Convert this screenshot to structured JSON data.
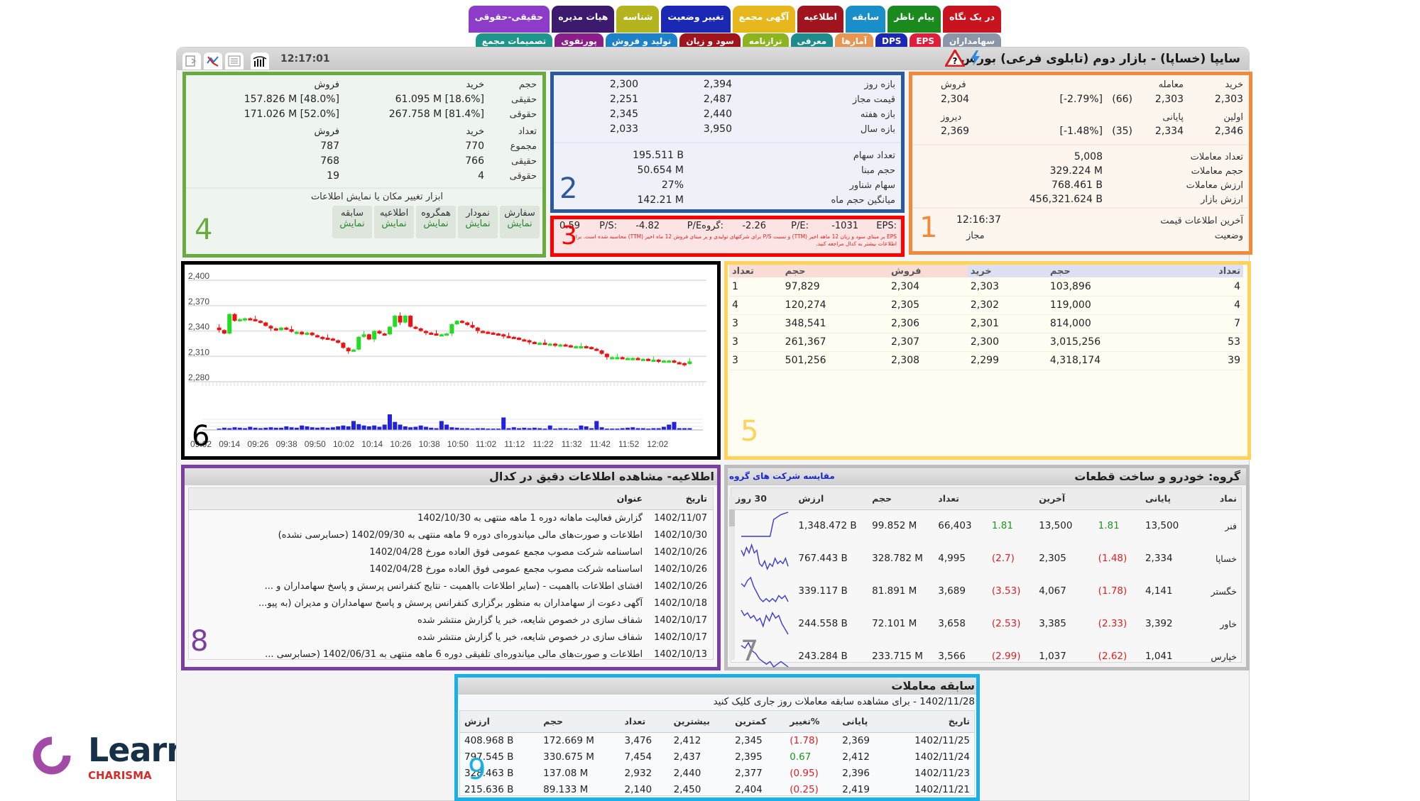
{
  "tabs": {
    "top": [
      {
        "label": "در یک نگاه",
        "color": "#c8141e"
      },
      {
        "label": "پیام ناظر",
        "color": "#1a8a1e"
      },
      {
        "label": "سابقه",
        "color": "#1a8ec8"
      },
      {
        "label": "اطلاعیه",
        "color": "#a0141e"
      },
      {
        "label": "آگهی مجمع",
        "color": "#e6b81e"
      },
      {
        "label": "تغییر وضعیت",
        "color": "#1a28b4"
      },
      {
        "label": "شناسه",
        "color": "#b4b41e"
      },
      {
        "label": "هیات مدیره",
        "color": "#3c1a6e"
      },
      {
        "label": "حقیقی-حقوقی",
        "color": "#8c3cc8"
      }
    ],
    "bottom": [
      {
        "label": "سهامداران",
        "color": "#8a96a8"
      },
      {
        "label": "EPS",
        "color": "#e01e3c"
      },
      {
        "label": "DPS",
        "color": "#1a28b4"
      },
      {
        "label": "آمارها",
        "color": "#e69650"
      },
      {
        "label": "معرفی",
        "color": "#1e8c8c"
      },
      {
        "label": "ترازنامه",
        "color": "#8cb41e"
      },
      {
        "label": "سود و زیان",
        "color": "#a0141e"
      },
      {
        "label": "تولید و فروش",
        "color": "#1e82c8"
      },
      {
        "label": "پورتفوی",
        "color": "#8c1e8c"
      },
      {
        "label": "تصمیمات مجمع",
        "color": "#1e968c"
      }
    ]
  },
  "window": {
    "title": "سایپا (خساپا) - بازار دوم (تابلوی فرعی) بورس",
    "clock": "12:17:01",
    "toolbar_icons": [
      "export-icon",
      "chart-line-icon",
      "list-icon",
      "bar-chart-icon"
    ]
  },
  "panel1": {
    "number": "1",
    "labels": {
      "buy": "خرید",
      "trade": "معامله",
      "sell": "فروش",
      "first": "اولین",
      "close": "پایانی",
      "yesterday": "دیروز"
    },
    "buy": "2,303",
    "trade_price": "2,303",
    "trade_change": "(66)",
    "trade_pct": "[-2.79%]",
    "sell": "2,304",
    "first": "2,346",
    "close_price": "2,334",
    "close_change": "(35)",
    "close_pct": "[-1.48%]",
    "yesterday": "2,369",
    "stats": [
      {
        "label": "تعداد معاملات",
        "value": "5,008"
      },
      {
        "label": "حجم معاملات",
        "value": "329.224 M"
      },
      {
        "label": "ارزش معاملات",
        "value": "768.461 B"
      },
      {
        "label": "ارزش بازار",
        "value": "456,321.624 B"
      }
    ],
    "last_update_label": "آخرین اطلاعات قیمت",
    "last_update": "12:16:37",
    "status_label": "وضعیت",
    "status": "مجاز"
  },
  "panel2": {
    "number": "2",
    "ranges": [
      {
        "label": "بازه روز",
        "high": "2,394",
        "low": "2,300"
      },
      {
        "label": "قیمت مجاز",
        "high": "2,487",
        "low": "2,251"
      },
      {
        "label": "بازه هفته",
        "high": "2,440",
        "low": "2,345"
      },
      {
        "label": "بازه سال",
        "high": "3,950",
        "low": "2,033"
      }
    ],
    "stats": [
      {
        "label": "تعداد سهام",
        "value": "195.511 B"
      },
      {
        "label": "حجم مبنا",
        "value": "50.654 M"
      },
      {
        "label": "سهام شناور",
        "value": "27%"
      },
      {
        "label": "میانگین حجم ماه",
        "value": "142.21 M"
      }
    ]
  },
  "panel3": {
    "number": "3",
    "eps_label": ":EPS",
    "eps": "1031-",
    "pe_label": ":P/E",
    "pe": "2.26-",
    "group_pe_label": ":گروهP/E",
    "group_pe": "4.82-",
    "ps_label": ":P/S",
    "ps": "0.59",
    "note": "EPS بر مبنای سود و زیان 12 ماهه اخیر (TTM) و نسبت P/S برای شرکتهای تولیدی و بر مبنای فروش 12 ماه اخیر (TTM) محاسبه شده است. برای اطلاعات بیشتر به کدال مراجعه کنید."
  },
  "panel4": {
    "number": "4",
    "vol_header": {
      "label": "حجم",
      "buy": "خرید",
      "sell": "فروش"
    },
    "vol_rows": [
      {
        "label": "حقیقی",
        "buy": "61.095 M [18.6%]",
        "sell": "157.826 M [48.0%]"
      },
      {
        "label": "حقوقی",
        "buy": "267.758 M [81.4%]",
        "sell": "171.026 M [52.0%]"
      }
    ],
    "count_header": {
      "label": "تعداد",
      "buy": "خرید",
      "sell": "فروش"
    },
    "count_rows": [
      {
        "label": "مجموع",
        "buy": "770",
        "sell": "787"
      },
      {
        "label": "حقیقی",
        "buy": "766",
        "sell": "768"
      },
      {
        "label": "حقوقی",
        "buy": "4",
        "sell": "19"
      }
    ],
    "tool_caption": "ابزار تغییر مکان یا نمایش اطلاعات",
    "tool_buttons": [
      {
        "label": "سفارش",
        "action": "نمایش"
      },
      {
        "label": "نمودار",
        "action": "نمایش"
      },
      {
        "label": "همگروه",
        "action": "نمایش"
      },
      {
        "label": "اطلاعیه",
        "action": "نمایش"
      },
      {
        "label": "سابقه",
        "action": "نمایش"
      }
    ]
  },
  "panel5": {
    "number": "5",
    "headers": [
      "تعداد",
      "حجم",
      "خرید",
      "فروش",
      "حجم",
      "تعداد"
    ],
    "rows": [
      {
        "buy_count": "4",
        "buy_vol": "103,896",
        "buy_price": "2,303",
        "sell_price": "2,304",
        "sell_vol": "97,829",
        "sell_count": "1"
      },
      {
        "buy_count": "4",
        "buy_vol": "119,000",
        "buy_price": "2,302",
        "sell_price": "2,305",
        "sell_vol": "120,274",
        "sell_count": "4"
      },
      {
        "buy_count": "7",
        "buy_vol": "814,000",
        "buy_price": "2,301",
        "sell_price": "2,306",
        "sell_vol": "348,541",
        "sell_count": "3"
      },
      {
        "buy_count": "53",
        "buy_vol": "3,015,256",
        "buy_price": "2,300",
        "sell_price": "2,307",
        "sell_vol": "261,367",
        "sell_count": "3"
      },
      {
        "buy_count": "39",
        "buy_vol": "4,318,174",
        "buy_price": "2,299",
        "sell_price": "2,308",
        "sell_vol": "501,256",
        "sell_count": "3"
      }
    ]
  },
  "panel6": {
    "number": "6"
  },
  "chart_data": {
    "type": "candlestick",
    "title": "",
    "ylim": [
      2280,
      2400
    ],
    "y_ticks": [
      "2,400",
      "2,370",
      "2,340",
      "2,310",
      "2,280"
    ],
    "y_tick_values": [
      2400,
      2370,
      2340,
      2310,
      2280
    ],
    "x_ticks": [
      "09:02",
      "09:14",
      "09:26",
      "09:38",
      "09:50",
      "10:02",
      "10:14",
      "10:26",
      "10:38",
      "10:50",
      "11:02",
      "11:12",
      "11:22",
      "11:32",
      "11:42",
      "11:52",
      "12:02"
    ],
    "up_color": "#22dd22",
    "down_color": "#ee1111",
    "volume_color": "#2222dd",
    "close": [
      2341,
      2337,
      2360,
      2352,
      2354,
      2355,
      2354,
      2352,
      2350,
      2346,
      2343,
      2341,
      2344,
      2342,
      2339,
      2339,
      2336,
      2338,
      2335,
      2333,
      2332,
      2331,
      2329,
      2326,
      2320,
      2316,
      2318,
      2333,
      2336,
      2330,
      2340,
      2337,
      2336,
      2345,
      2358,
      2350,
      2358,
      2345,
      2343,
      2340,
      2338,
      2337,
      2336,
      2336,
      2337,
      2348,
      2352,
      2350,
      2347,
      2344,
      2340,
      2339,
      2338,
      2337,
      2336,
      2334,
      2333,
      2332,
      2330,
      2329,
      2327,
      2326,
      2326,
      2325,
      2325,
      2324,
      2324,
      2323,
      2322,
      2322,
      2322,
      2321,
      2319,
      2317,
      2313,
      2309,
      2309,
      2309,
      2308,
      2308,
      2308,
      2307,
      2307,
      2306,
      2306,
      2305,
      2305,
      2305,
      2303,
      2302,
      2301,
      2304
    ],
    "volume": [
      0.3,
      0.5,
      0.4,
      0.6,
      0.5,
      0.4,
      0.7,
      0.5,
      0.4,
      0.5,
      0.6,
      0.5,
      0.5,
      0.8,
      0.6,
      0.5,
      1.0,
      0.8,
      0.6,
      0.5,
      0.6,
      0.5,
      0.6,
      0.8,
      1.0,
      0.8,
      2.0,
      1.3,
      1.0,
      0.8,
      1.0,
      0.7,
      1.2,
      3.5,
      1.8,
      1.2,
      0.8,
      0.6,
      0.7,
      1.0,
      0.7,
      0.5,
      0.4,
      2.0,
      1.2,
      0.6,
      0.5,
      0.4,
      0.4,
      0.3,
      0.4,
      0.4,
      0.3,
      0.3,
      0.3,
      2.8,
      0.4,
      0.6,
      0.4,
      0.5,
      0.4,
      0.5,
      0.4,
      0.3,
      1.0,
      0.3,
      0.4,
      0.4,
      0.3,
      0.3,
      1.0,
      0.8,
      0.4,
      2.0,
      0.6,
      0.3,
      0.3,
      0.3,
      0.4,
      0.5,
      0.6,
      0.4,
      0.4,
      0.3,
      0.4,
      0.4,
      0.7,
      1.2,
      1.8,
      0.4,
      0.4,
      0.4
    ],
    "legend": "none",
    "grid": true
  },
  "panel7": {
    "number": "7",
    "title": "گروه: خودرو و ساخت قطعات",
    "compare_link": "مقایسه شرکت های گروه",
    "headers": [
      "نماد",
      "پایانی",
      "",
      "آخرین",
      "",
      "تعداد",
      "حجم",
      "ارزش",
      "30 روز"
    ],
    "rows": [
      {
        "symbol": "فنر",
        "close": "13,500",
        "close_chg": "1.81",
        "close_pos": true,
        "last": "13,500",
        "last_chg": "1.81",
        "last_pos": true,
        "count": "66,403",
        "vol": "99.852 M",
        "value": "1,348.472 B",
        "spark": [
          0,
          0,
          0,
          0,
          0,
          0,
          0,
          0,
          0,
          7,
          8,
          9,
          9.5,
          10
        ]
      },
      {
        "symbol": "خساپا",
        "close": "2,334",
        "close_chg": "(1.48)",
        "close_pos": false,
        "last": "2,305",
        "last_chg": "(2.7)",
        "last_pos": false,
        "count": "4,995",
        "vol": "328.782 M",
        "value": "767.443 B",
        "spark": [
          8,
          6,
          9,
          7,
          10,
          7,
          8,
          3,
          2,
          4,
          1,
          3,
          2,
          5,
          3,
          4,
          3,
          5,
          2
        ]
      },
      {
        "symbol": "خگستر",
        "close": "4,141",
        "close_chg": "(1.78)",
        "close_pos": false,
        "last": "4,067",
        "last_chg": "(3.53)",
        "last_pos": false,
        "count": "3,689",
        "vol": "81.891 M",
        "value": "339.117 B",
        "spark": [
          8,
          7,
          9,
          10,
          7,
          5,
          3,
          2,
          3,
          2,
          3,
          2,
          4,
          3,
          4,
          2
        ]
      },
      {
        "symbol": "خاور",
        "close": "3,392",
        "close_chg": "(2.33)",
        "close_pos": false,
        "last": "3,385",
        "last_chg": "(2.53)",
        "last_pos": false,
        "count": "3,658",
        "vol": "72.101 M",
        "value": "244.558 B",
        "spark": [
          9,
          7,
          8,
          6,
          7,
          5,
          6,
          3,
          7,
          5,
          8,
          6,
          7,
          4,
          2,
          0
        ]
      },
      {
        "symbol": "خپارس",
        "close": "1,041",
        "close_chg": "(2.62)",
        "close_pos": false,
        "last": "1,037",
        "last_chg": "(2.99)",
        "last_pos": false,
        "count": "3,566",
        "vol": "233.715 M",
        "value": "243.284 B",
        "spark": [
          9,
          8,
          10,
          7,
          6,
          4,
          3,
          2,
          3,
          1,
          2,
          3,
          2,
          1
        ]
      }
    ]
  },
  "panel8": {
    "number": "8",
    "title": "اطلاعیه- مشاهده اطلاعات دقیق در کدال",
    "headers": {
      "date": "تاریخ",
      "title": "عنوان"
    },
    "rows": [
      {
        "date": "1402/11/07",
        "title": "گزارش فعالیت ماهانه دوره 1 ماهه منتهی به 1402/10/30"
      },
      {
        "date": "1402/10/30",
        "title": "اطلاعات و صورت‌های مالی میاندوره‌ای دوره 9 ماهه منتهی به 1402/09/30 (حسابرسی نشده)"
      },
      {
        "date": "1402/10/26",
        "title": "اساسنامه شرکت مصوب مجمع عمومی فوق العاده مورخ 1402/04/28"
      },
      {
        "date": "1402/10/26",
        "title": "اساسنامه شرکت مصوب مجمع عمومی فوق العاده مورخ 1402/04/28"
      },
      {
        "date": "1402/10/26",
        "title": "افشای اطلاعات بااهمیت - (سایر اطلاعات بااهمیت - نتایج کنفرانس پرسش و پاسخ سهامداران و ..."
      },
      {
        "date": "1402/10/18",
        "title": "آگهی دعوت از سهامداران به منظور برگزاری کنفرانس پرسش و پاسخ سهامداران و مدیران (به پیو..."
      },
      {
        "date": "1402/10/17",
        "title": "شفاف سازی در خصوص شایعه، خبر یا گزارش منتشر شده"
      },
      {
        "date": "1402/10/17",
        "title": "شفاف سازی در خصوص شایعه، خبر یا گزارش منتشر شده"
      },
      {
        "date": "1402/10/13",
        "title": "اطلاعات و صورت‌های مالی میاندوره‌ای تلفیقی دوره 6 ماهه منتهی به 1402/06/31 (حسابرسی ..."
      }
    ]
  },
  "panel9": {
    "number": "9",
    "title": "سابقه معاملات",
    "subtitle": "1402/11/28 - برای مشاهده سابقه معاملات روز جاری کلیک کنید",
    "headers": [
      "تاریخ",
      "پایانی",
      "%تغییر",
      "کمترین",
      "بیشترین",
      "تعداد",
      "حجم",
      "ارزش"
    ],
    "rows": [
      {
        "date": "1402/11/25",
        "close": "2,369",
        "change": "(1.78)",
        "pos": false,
        "low": "2,345",
        "high": "2,412",
        "count": "3,476",
        "vol": "172.669 M",
        "value": "408.968 B"
      },
      {
        "date": "1402/11/24",
        "close": "2,412",
        "change": "0.67",
        "pos": true,
        "low": "2,395",
        "high": "2,437",
        "count": "7,454",
        "vol": "330.675 M",
        "value": "797.545 B"
      },
      {
        "date": "1402/11/23",
        "close": "2,396",
        "change": "(0.95)",
        "pos": false,
        "low": "2,377",
        "high": "2,440",
        "count": "2,932",
        "vol": "137.08 M",
        "value": "328.463 B"
      },
      {
        "date": "1402/11/21",
        "close": "2,419",
        "change": "(0.25)",
        "pos": false,
        "low": "2,404",
        "high": "2,450",
        "count": "2,140",
        "vol": "89.133 M",
        "value": "215.636 B"
      }
    ]
  },
  "brand": {
    "name": "Learning",
    "sub": "CHARISMA"
  }
}
